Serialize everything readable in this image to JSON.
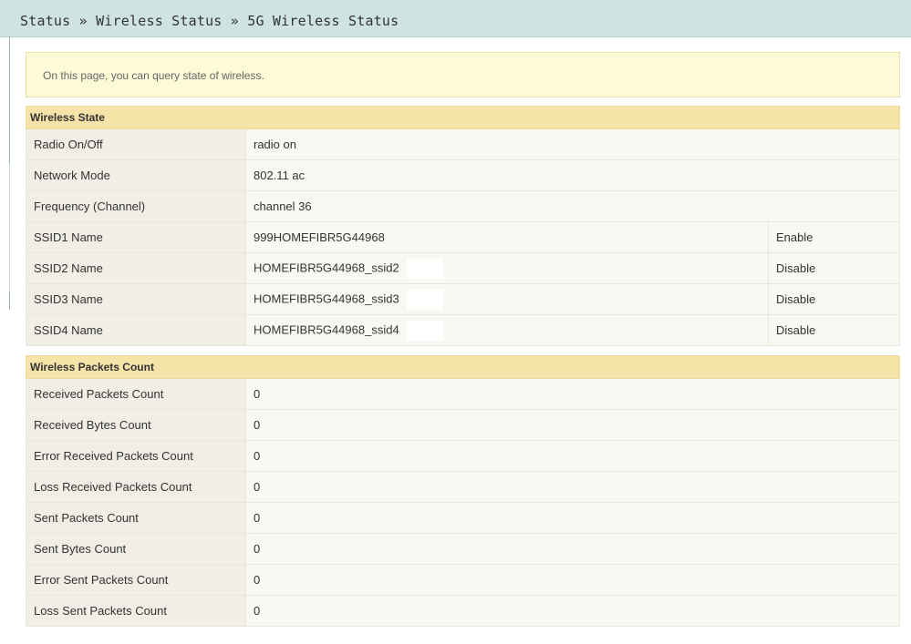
{
  "breadcrumb": "Status » Wireless Status » 5G Wireless Status",
  "notice": "On this page, you can query state of wireless.",
  "wireless_state": {
    "title": "Wireless State",
    "rows": [
      {
        "label": "Radio On/Off",
        "value": "radio on"
      },
      {
        "label": "Network Mode",
        "value": "802.11 ac"
      },
      {
        "label": "Frequency (Channel)",
        "value": "channel 36"
      }
    ],
    "ssids": [
      {
        "label": "SSID1 Name",
        "value": "999HOMEFIBR5G44968",
        "status": "Enable"
      },
      {
        "label": "SSID2 Name",
        "value": "HOMEFIBR5G44968_ssid2",
        "status": "Disable"
      },
      {
        "label": "SSID3 Name",
        "value": "HOMEFIBR5G44968_ssid3",
        "status": "Disable"
      },
      {
        "label": "SSID4 Name",
        "value": "HOMEFIBR5G44968_ssid4",
        "status": "Disable"
      }
    ]
  },
  "packets": {
    "title": "Wireless Packets Count",
    "rows": [
      {
        "label": "Received Packets Count",
        "value": "0"
      },
      {
        "label": "Received Bytes Count",
        "value": "0"
      },
      {
        "label": "Error Received Packets Count",
        "value": "0"
      },
      {
        "label": "Loss Received Packets Count",
        "value": "0"
      },
      {
        "label": "Sent Packets Count",
        "value": "0"
      },
      {
        "label": "Sent Bytes Count",
        "value": "0"
      },
      {
        "label": "Error Sent Packets Count",
        "value": "0"
      },
      {
        "label": "Loss Sent Packets Count",
        "value": "0"
      }
    ]
  }
}
